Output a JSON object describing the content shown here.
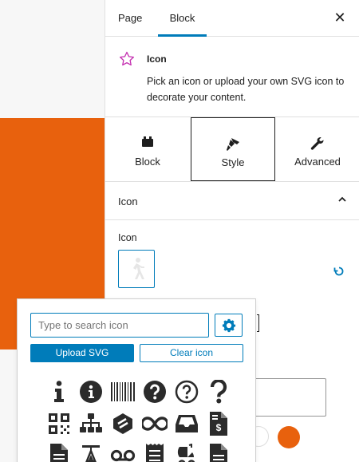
{
  "sidebar": {
    "tabs": [
      {
        "label": "Page"
      },
      {
        "label": "Block",
        "active": true
      }
    ],
    "close_icon": "close-icon"
  },
  "block_card": {
    "icon": "star-outline-icon",
    "title": "Icon",
    "description": "Pick an icon or upload your own SVG icon to decorate your content."
  },
  "style_tabs": [
    {
      "label": "Block",
      "icon": "block-icon"
    },
    {
      "label": "Style",
      "icon": "paintbrush-icon",
      "selected": true
    },
    {
      "label": "Advanced",
      "icon": "wrench-icon"
    }
  ],
  "panel": {
    "title": "Icon",
    "chevron_icon": "chevron-up-icon",
    "field_label": "Icon",
    "preview_icon": "walking-figure-icon",
    "reset_icon": "reset-icon"
  },
  "popover": {
    "search_placeholder": "Type to search icon",
    "search_value": "",
    "upload_label": "Upload SVG",
    "clear_label": "Clear icon",
    "settings_icon": "gear-icon",
    "icons": [
      "info-icon",
      "info-circle-icon",
      "barcode-icon",
      "question-circle-icon",
      "question-circle-outline-icon",
      "question-icon",
      "qrcode-icon",
      "sitemap-icon",
      "stack-icon",
      "infinity-icon",
      "inbox-icon",
      "invoice-dollar-icon",
      "file-lines-icon",
      "text-height-icon",
      "voicemail-icon",
      "receipt-icon",
      "baby-carriage-icon",
      "file-alt-icon"
    ]
  },
  "colors": {
    "accent": "#007cba",
    "orange": "#e8610d",
    "text": "#1e1e1e",
    "star": "#c42fb0"
  }
}
